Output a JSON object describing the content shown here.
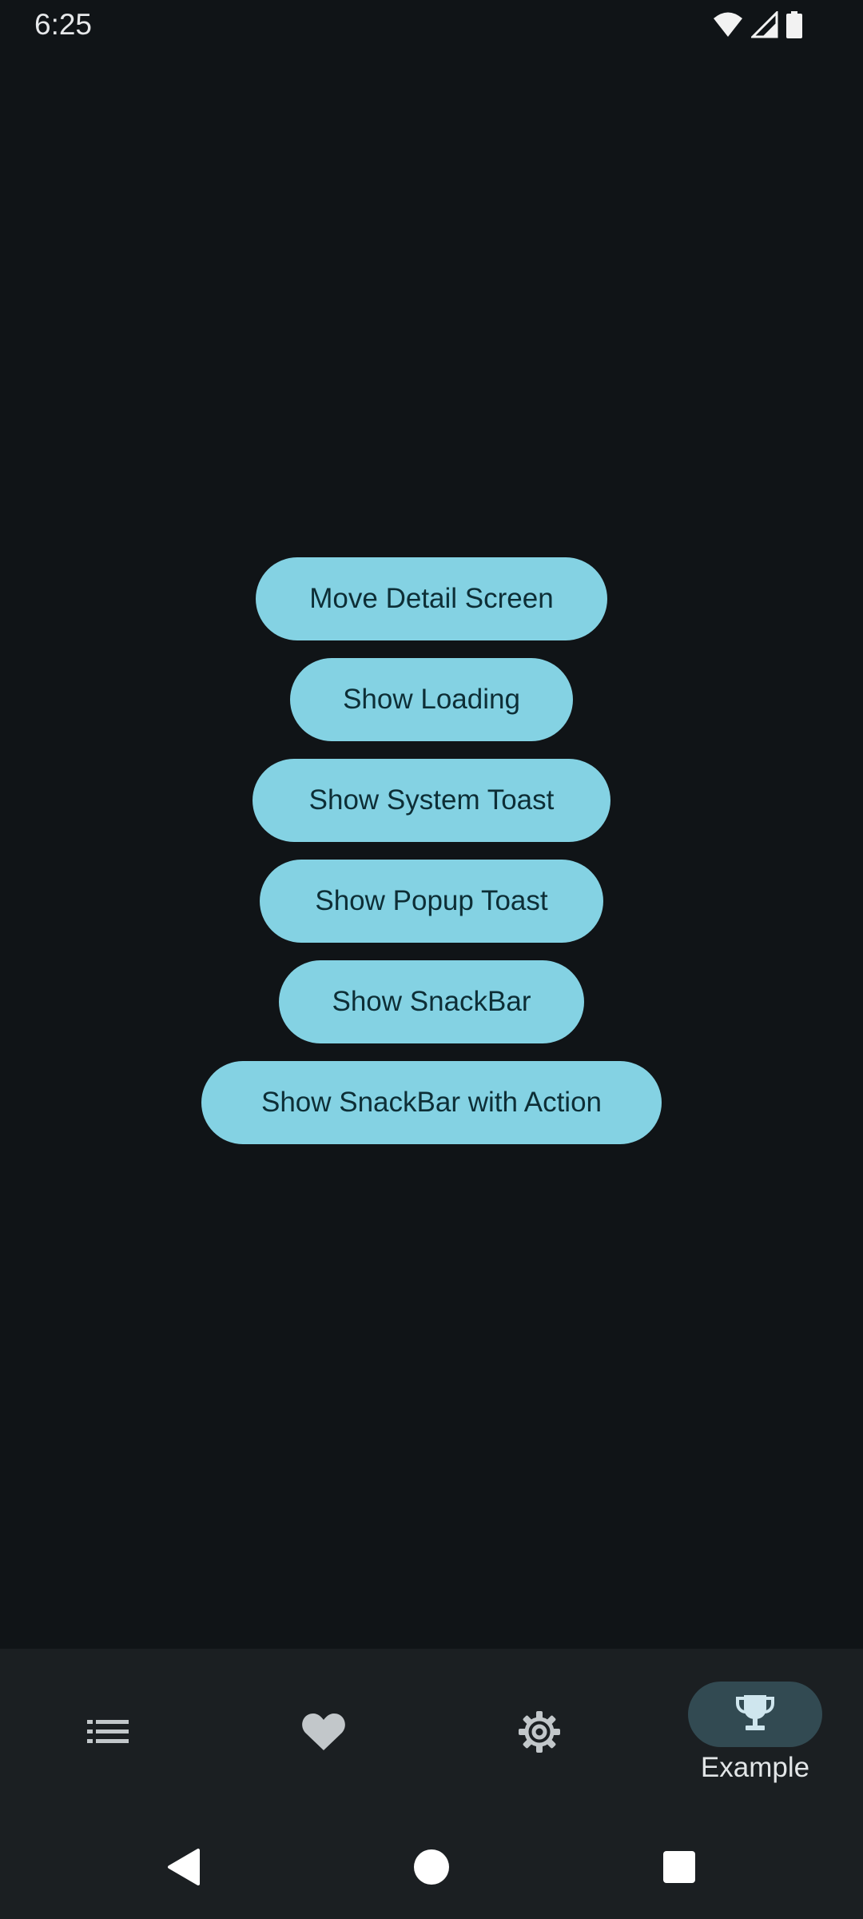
{
  "status_bar": {
    "time": "6:25",
    "icons": [
      "wifi-icon",
      "cellular-signal-icon",
      "battery-icon"
    ]
  },
  "buttons": [
    {
      "label": "Move Detail Screen"
    },
    {
      "label": "Show Loading"
    },
    {
      "label": "Show System Toast"
    },
    {
      "label": "Show Popup Toast"
    },
    {
      "label": "Show SnackBar"
    },
    {
      "label": "Show SnackBar with Action"
    }
  ],
  "bottom_nav": {
    "items": [
      {
        "icon": "list-icon",
        "label": "",
        "selected": false
      },
      {
        "icon": "heart-icon",
        "label": "",
        "selected": false
      },
      {
        "icon": "gear-icon",
        "label": "",
        "selected": false
      },
      {
        "icon": "trophy-icon",
        "label": "Example",
        "selected": true
      }
    ]
  },
  "system_nav": {
    "icons": [
      "back-icon",
      "home-icon",
      "recents-icon"
    ]
  },
  "colors": {
    "background": "#101417",
    "button_fill": "#84d2e3",
    "button_text": "#0d2e36",
    "nav_background": "#1b1f22",
    "nav_indicator": "#324a52",
    "icon_inactive": "#c2c7ca",
    "icon_active": "#cfe6ee"
  }
}
